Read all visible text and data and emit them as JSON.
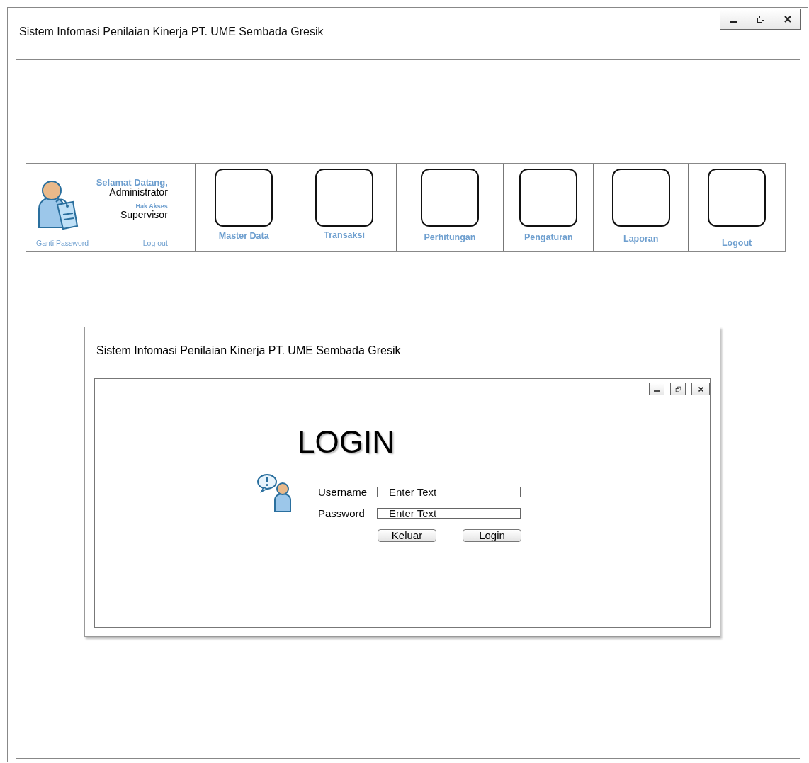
{
  "window": {
    "title": "Sistem Infomasi Penilaian Kinerja PT. UME Sembada Gresik"
  },
  "user_panel": {
    "greeting": "Selamat Datang,",
    "name": "Administrator",
    "role_label": "Hak Akses",
    "role": "Supervisor",
    "links": [
      "Ganti Password",
      "Log out"
    ]
  },
  "menu": [
    {
      "label": "Master Data"
    },
    {
      "label": "Transaksi"
    },
    {
      "label": "Perhitungan"
    },
    {
      "label": "Pengaturan"
    },
    {
      "label": "Laporan"
    },
    {
      "label": "Logout"
    }
  ],
  "dialog": {
    "title": "Sistem Infomasi Penilaian Kinerja PT. UME Sembada Gresik",
    "heading": "LOGIN",
    "fields": [
      {
        "label": "Username",
        "placeholder": "Enter Text"
      },
      {
        "label": "Password",
        "placeholder": "Enter Text"
      }
    ],
    "buttons": [
      "Keluar",
      "Login"
    ]
  }
}
